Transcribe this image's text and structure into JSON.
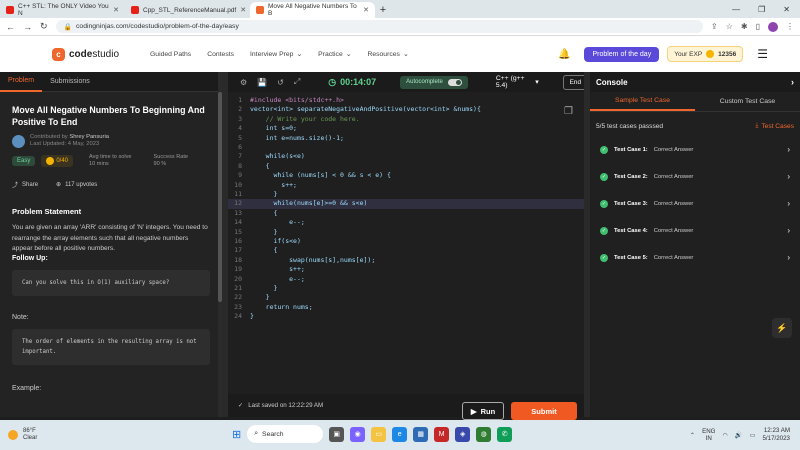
{
  "browser": {
    "tabs": [
      {
        "label": "C++ STL: The ONLY Video You N",
        "favicon_color": "#e62117"
      },
      {
        "label": "Cpp_STL_ReferenceManual.pdf",
        "favicon_color": "#e62117"
      },
      {
        "label": "Move All Negative Numbers To B",
        "favicon_color": "#f0672e"
      }
    ],
    "url": "codingninjas.com/codestudio/problem-of-the-day/easy"
  },
  "site": {
    "logo_a": "code",
    "logo_b": "studio",
    "nav": [
      "Guided Paths",
      "Contests",
      "Interview Prep",
      "Practice",
      "Resources"
    ],
    "potd_label": "Problem of the day",
    "exp_label": "Your EXP",
    "exp_value": "12356"
  },
  "left": {
    "tabs": [
      "Problem",
      "Submissions"
    ],
    "title": "Move All Negative Numbers To Beginning And Positive To End",
    "contributed_prefix": "Contributed by",
    "contributor": "Shrey Pansuria",
    "last_updated": "Last Updated: 4 May, 2023",
    "difficulty": "Easy",
    "score": "0/40",
    "avg_time_label": "Avg time to solve",
    "avg_time_value": "10 mins",
    "success_label": "Success Rate",
    "success_value": "90 %",
    "share_label": "Share",
    "upvotes": "117 upvotes",
    "statement_heading": "Problem Statement",
    "statement": "You are given an array 'ARR' consisting of 'N' integers. You need to rearrange the array elements such that all negative numbers appear before all positive numbers.",
    "follow_up": "Follow Up:",
    "follow_code": "Can you solve this in O(1) auxiliary space?",
    "note_label": "Note:",
    "note_code": "The order of elements in the resulting array is not important.",
    "example_label": "Example:"
  },
  "editor": {
    "timer": "00:14:07",
    "autocomplete": "Autocomplete",
    "language": "C++ (g++ 5.4)",
    "end_label": "End",
    "saved": "Last saved on 12:22:29 AM",
    "run_label": "Run",
    "submit_label": "Submit",
    "highlight_line": 12,
    "lines": [
      "#include <bits/stdc++.h>",
      "vector<int> separateNegativeAndPositive(vector<int> &nums){",
      "    // Write your code here.",
      "    int s=0;",
      "    int e=nums.size()-1;",
      "",
      "    while(s<e)",
      "    {",
      "      while (nums[s] < 0 && s < e) {",
      "        s++;",
      "      }",
      "      while(nums[e]>=0 && s<e)",
      "      {",
      "          e--;",
      "      }",
      "      if(s<e)",
      "      {",
      "          swap(nums[s],nums[e]);",
      "          s++;",
      "          e--;",
      "      }",
      "    }",
      "    return nums;",
      "}"
    ]
  },
  "console": {
    "title": "Console",
    "tabs": [
      "Sample Test Case",
      "Custom Test Case"
    ],
    "passed": "5/5 test cases passsed",
    "test_cases_label": "Test Cases",
    "cases": [
      {
        "name": "Test Case 1:",
        "result": "Correct Answer"
      },
      {
        "name": "Test Case 2:",
        "result": "Correct Answer"
      },
      {
        "name": "Test Case 3:",
        "result": "Correct Answer"
      },
      {
        "name": "Test Case 4:",
        "result": "Correct Answer"
      },
      {
        "name": "Test Case 5:",
        "result": "Correct Answer"
      }
    ]
  },
  "taskbar": {
    "temp": "86°F",
    "weather": "Clear",
    "search": "Search",
    "lang_a": "ENG",
    "lang_b": "IN",
    "time": "12:23 AM",
    "date": "5/17/2023"
  }
}
